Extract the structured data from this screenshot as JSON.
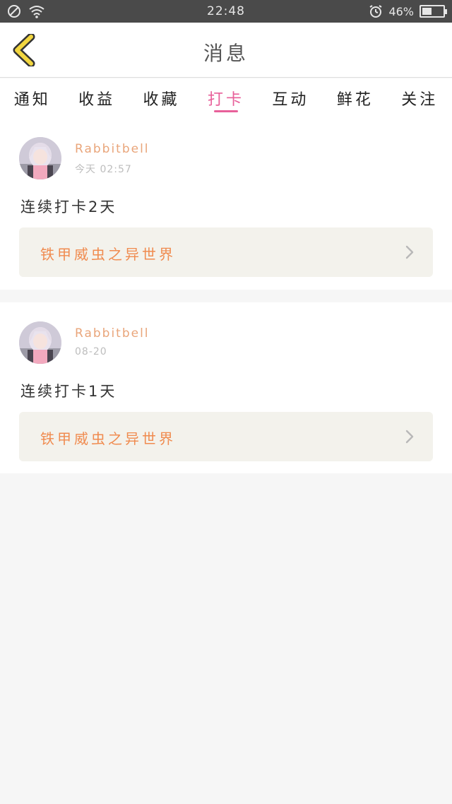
{
  "status_bar": {
    "time": "22:48",
    "battery_percent": "46%",
    "battery_level": 0.46,
    "icons": [
      "no-sim-icon",
      "wifi-icon",
      "alarm-icon",
      "battery-icon"
    ]
  },
  "header": {
    "title": "消息",
    "back_icon": "chevron-left-icon",
    "back_color": "#f2d640"
  },
  "tabs": [
    {
      "label": "通知",
      "active": false
    },
    {
      "label": "收益",
      "active": false
    },
    {
      "label": "收藏",
      "active": false
    },
    {
      "label": "打卡",
      "active": true
    },
    {
      "label": "互动",
      "active": false
    },
    {
      "label": "鲜花",
      "active": false
    },
    {
      "label": "关注",
      "active": false
    }
  ],
  "accent_color": "#e8609a",
  "messages": [
    {
      "username": "Rabbitbell",
      "time": "今天 02:57",
      "text": "连续打卡2天",
      "link": "铁甲威虫之异世界"
    },
    {
      "username": "Rabbitbell",
      "time": "08-20",
      "text": "连续打卡1天",
      "link": "铁甲威虫之异世界"
    }
  ]
}
